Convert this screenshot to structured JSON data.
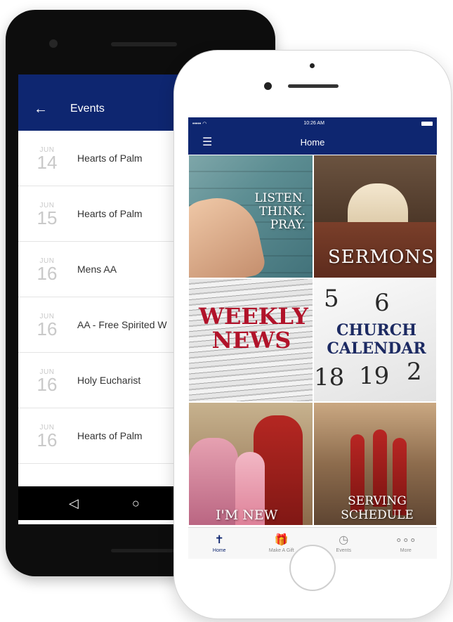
{
  "android": {
    "header": {
      "title": "Events",
      "back_icon": "arrow-left-icon"
    },
    "events": [
      {
        "month": "JUN",
        "day": "14",
        "name": "Hearts of Palm"
      },
      {
        "month": "JUN",
        "day": "15",
        "name": "Hearts of Palm"
      },
      {
        "month": "JUN",
        "day": "16",
        "name": "Mens AA"
      },
      {
        "month": "JUN",
        "day": "16",
        "name": "AA - Free Spirited W"
      },
      {
        "month": "JUN",
        "day": "16",
        "name": "Holy Eucharist"
      },
      {
        "month": "JUN",
        "day": "16",
        "name": "Hearts of Palm"
      }
    ],
    "nav": {
      "back": "◁",
      "home": "○"
    }
  },
  "iphone": {
    "status": {
      "signal": "•••••  ◠",
      "time": "10:26 AM"
    },
    "header": {
      "title": "Home",
      "menu_icon": "hamburger-menu-icon"
    },
    "tiles": {
      "listen": [
        "LISTEN.",
        "THINK.",
        "PRAY."
      ],
      "sermons": "SERMONS",
      "weekly": [
        "WEEKLY",
        "NEWS"
      ],
      "calendar": [
        "CHURCH",
        "CALENDAR"
      ],
      "new": "I'M NEW",
      "serving": [
        "SERVING",
        "SCHEDULE"
      ]
    },
    "tabs": [
      {
        "label": "Home",
        "icon": "cross-icon",
        "glyph": "✝"
      },
      {
        "label": "Make A Gift",
        "icon": "gift-icon",
        "glyph": "🎁"
      },
      {
        "label": "Events",
        "icon": "clock-icon",
        "glyph": "◷"
      },
      {
        "label": "More",
        "icon": "more-dots-icon",
        "glyph": "∘∘∘"
      }
    ]
  },
  "colors": {
    "primary": "#0e2670",
    "weekly_red": "#b1132a",
    "calendar_navy": "#1c2a62"
  }
}
